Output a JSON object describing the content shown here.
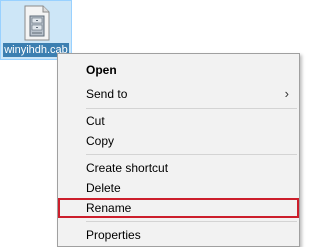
{
  "desktop": {
    "file_name": "winyihdh.cab"
  },
  "context_menu": {
    "items": [
      {
        "label": "Open"
      },
      {
        "label": "Send to"
      },
      {
        "label": "Cut"
      },
      {
        "label": "Copy"
      },
      {
        "label": "Create shortcut"
      },
      {
        "label": "Delete"
      },
      {
        "label": "Rename"
      },
      {
        "label": "Properties"
      }
    ],
    "submenu_glyph": "›"
  },
  "colors": {
    "highlight": "#cc1e2b",
    "selection": "#cde6f7"
  }
}
